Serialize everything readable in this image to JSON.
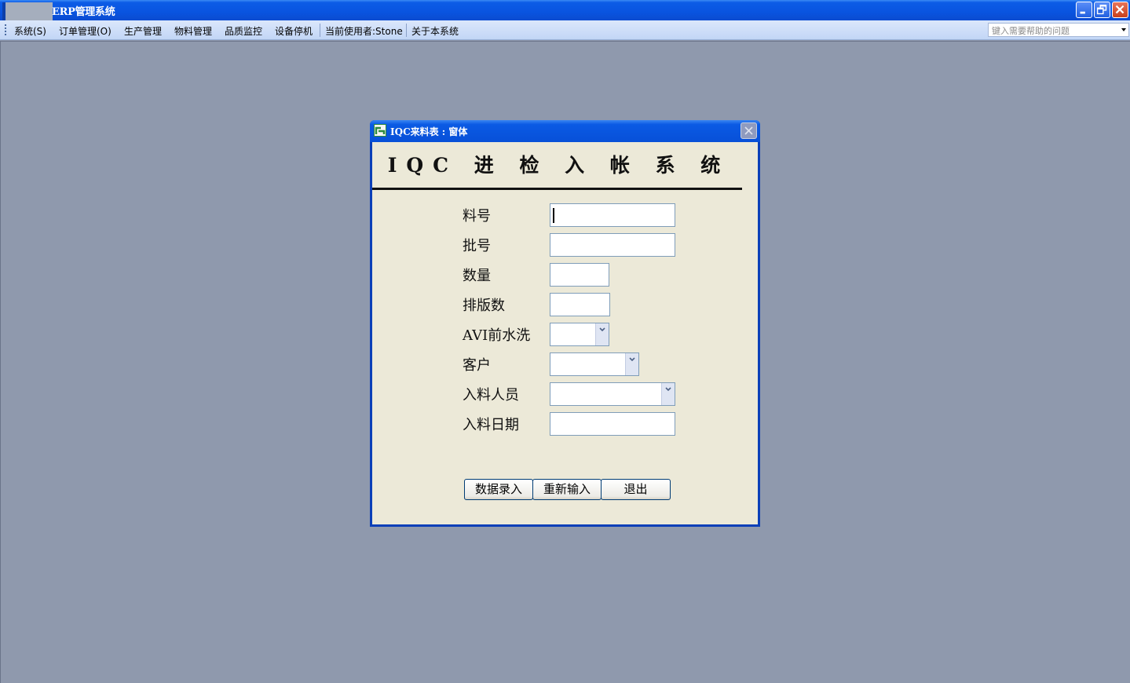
{
  "app": {
    "title": "ERP管理系统"
  },
  "menu": {
    "items": [
      "系统(S)",
      "订单管理(O)",
      "生产管理",
      "物料管理",
      "品质监控",
      "设备停机",
      "当前使用者:Stone",
      "关于本系统"
    ],
    "help_placeholder": "键入需要帮助的问题"
  },
  "dialog": {
    "title": "IQC来料表 : 窗体",
    "heading": "IQC 进 检 入 帐 系 统",
    "fields": [
      {
        "label": "料号",
        "type": "text",
        "value": ""
      },
      {
        "label": "批号",
        "type": "text",
        "value": ""
      },
      {
        "label": "数量",
        "type": "text",
        "value": ""
      },
      {
        "label": "排版数",
        "type": "text",
        "value": ""
      },
      {
        "label": "AVI前水洗",
        "type": "combo",
        "value": ""
      },
      {
        "label": "客户",
        "type": "combo",
        "value": ""
      },
      {
        "label": "入料人员",
        "type": "combo",
        "value": ""
      },
      {
        "label": "入料日期",
        "type": "text",
        "value": ""
      }
    ],
    "buttons": [
      "数据录入",
      "重新输入",
      "退出"
    ]
  },
  "colors": {
    "titlebar": "#0954e0",
    "workspace": "#8f99ad",
    "dialog_body": "#ece9d8",
    "menubar": "#c2d6f6"
  }
}
